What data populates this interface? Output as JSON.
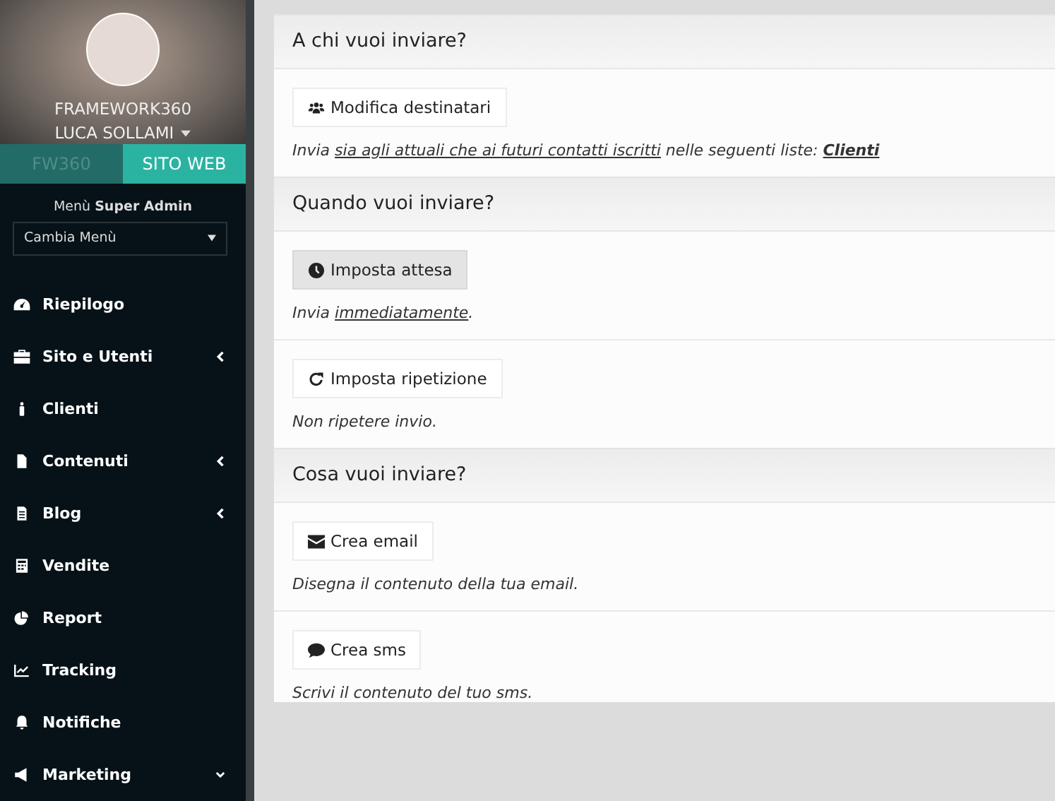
{
  "profile": {
    "company": "FRAMEWORK360",
    "user": "LUCA SOLLAMI"
  },
  "tabs": [
    {
      "label": "FW360",
      "selected": false
    },
    {
      "label": "SITO WEB",
      "selected": true
    }
  ],
  "menu_label": "Menù **Super Admin**",
  "menu_select": {
    "value": "Cambia Menù"
  },
  "sidebar": {
    "items": [
      {
        "kind": "gauge",
        "label": "Riepilogo",
        "submenu": false
      },
      {
        "kind": "briefcase",
        "label": "Sito e Utenti",
        "submenu": true,
        "expanded": false
      },
      {
        "kind": "person",
        "label": "Clienti",
        "submenu": false
      },
      {
        "kind": "file",
        "label": "Contenuti",
        "submenu": true,
        "expanded": false
      },
      {
        "kind": "document",
        "label": "Blog",
        "submenu": true,
        "expanded": false
      },
      {
        "kind": "calculator",
        "label": "Vendite",
        "submenu": false
      },
      {
        "kind": "pie",
        "label": "Report",
        "submenu": false
      },
      {
        "kind": "chart",
        "label": "Tracking",
        "submenu": false
      },
      {
        "kind": "bell",
        "label": "Notifiche",
        "submenu": false
      },
      {
        "kind": "megaphone",
        "label": "Marketing",
        "submenu": true,
        "expanded": true
      }
    ]
  },
  "sections": [
    {
      "title": "A chi vuoi inviare?",
      "blocks": [
        {
          "button": {
            "kind": "users",
            "label": "Modifica destinatari",
            "hovered": false
          },
          "description": [
            {
              "text": "Invia ",
              "underline": false,
              "bold": false
            },
            {
              "text": "sia agli attuali che ai futuri contatti iscritti",
              "underline": true,
              "bold": false
            },
            {
              "text": " nelle seguenti liste: ",
              "underline": false,
              "bold": false
            },
            {
              "text": "Clienti",
              "underline": true,
              "bold": true
            }
          ]
        }
      ]
    },
    {
      "title": "Quando vuoi inviare?",
      "blocks": [
        {
          "button": {
            "kind": "clock",
            "label": "Imposta attesa",
            "hovered": true
          },
          "description": [
            {
              "text": "Invia ",
              "underline": false,
              "bold": false
            },
            {
              "text": "immediatamente",
              "underline": true,
              "bold": false
            },
            {
              "text": ".",
              "underline": false,
              "bold": false
            }
          ]
        },
        {
          "button": {
            "kind": "redo",
            "label": "Imposta ripetizione",
            "hovered": false
          },
          "description": [
            {
              "text": "Non ripetere invio.",
              "underline": false,
              "bold": false
            }
          ]
        }
      ]
    },
    {
      "title": "Cosa vuoi inviare?",
      "blocks": [
        {
          "button": {
            "kind": "envelope",
            "label": "Crea email",
            "hovered": false
          },
          "description": [
            {
              "text": "Disegna il contenuto della tua email.",
              "underline": false,
              "bold": false
            }
          ]
        },
        {
          "button": {
            "kind": "sms",
            "label": "Crea sms",
            "hovered": false
          },
          "description": [
            {
              "text": "Scrivi il contenuto del tuo sms.",
              "underline": false,
              "bold": false
            }
          ]
        }
      ]
    }
  ]
}
